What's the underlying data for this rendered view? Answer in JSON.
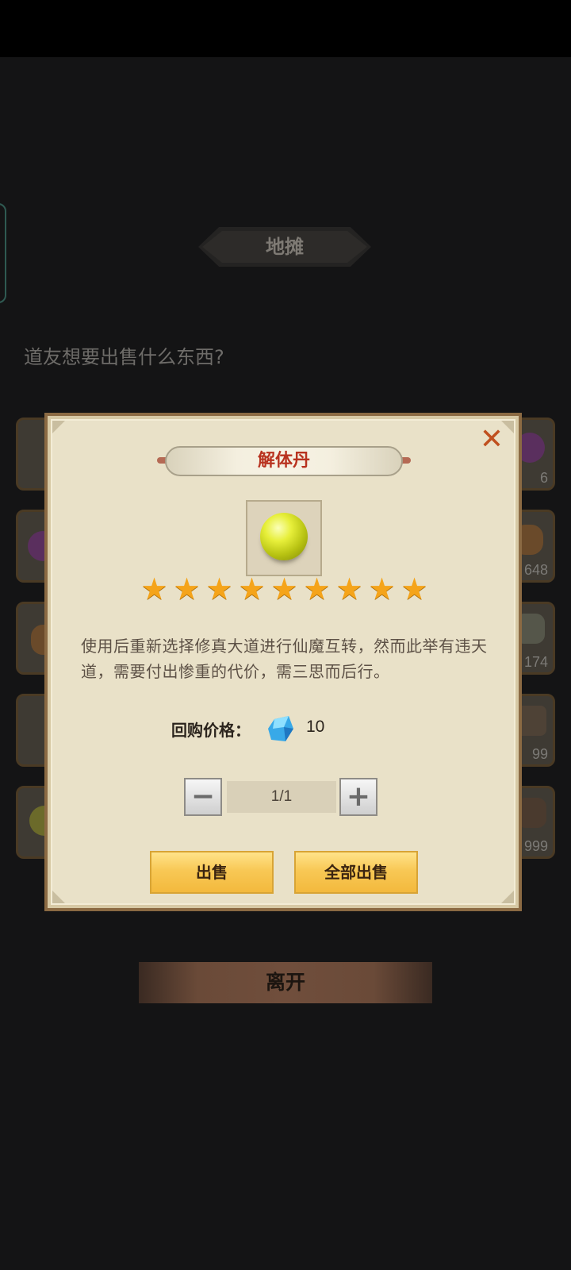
{
  "header": {
    "title": "地摊"
  },
  "prompt": "道友想要出售什么东西?",
  "background_slots": {
    "right_counts": [
      "6",
      "648",
      "174",
      "99",
      "999"
    ]
  },
  "footer": {
    "leave_label": "离开"
  },
  "dialog": {
    "item_name": "解体丹",
    "star_count": 9,
    "description": "使用后重新选择修真大道进行仙魔互转，然而此举有违天道，需要付出惨重的代价，需三思而后行。",
    "price_label": "回购价格：",
    "price_value": "10",
    "price_icon": "gem-icon",
    "quantity": "1/1",
    "minus_label": "−",
    "plus_label": "+",
    "sell_label": "出售",
    "sell_all_label": "全部出售",
    "close_icon": "close-icon"
  },
  "colors": {
    "dialog_bg": "#e9e1c8",
    "accent_red": "#b8321f",
    "star": "#f5a41a",
    "button_gold": "#f8c855"
  }
}
